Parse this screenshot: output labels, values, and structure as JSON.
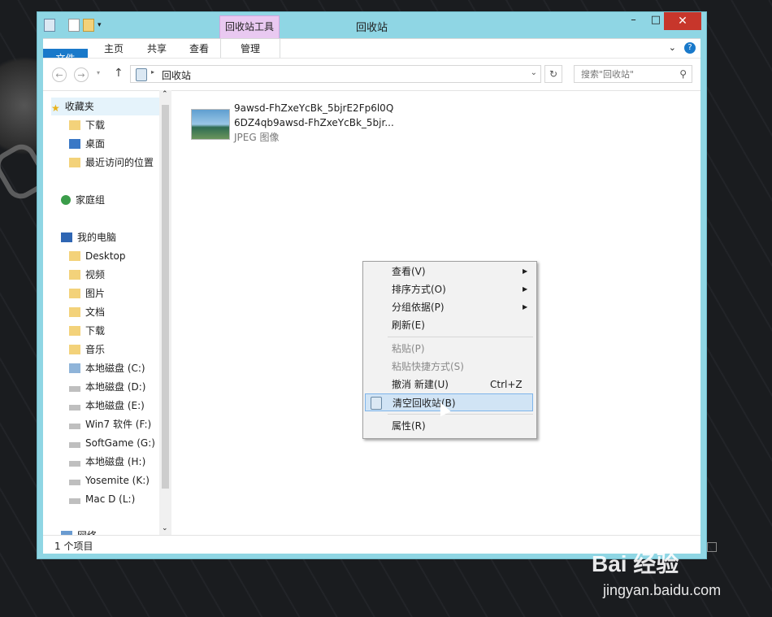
{
  "window": {
    "title": "回收站",
    "context_tab": "回收站工具",
    "close": "✕",
    "minimize": "–",
    "maximize": "□"
  },
  "ribbon": {
    "tabs": [
      "文件",
      "主页",
      "共享",
      "查看",
      "管理"
    ]
  },
  "address": {
    "path": "回收站",
    "search_placeholder": "搜索\"回收站\""
  },
  "sidebar": {
    "items": [
      {
        "label": "收藏夹"
      },
      {
        "label": "下载"
      },
      {
        "label": "桌面"
      },
      {
        "label": "最近访问的位置"
      },
      {
        "label": "家庭组"
      },
      {
        "label": "我的电脑"
      },
      {
        "label": "Desktop"
      },
      {
        "label": "视频"
      },
      {
        "label": "图片"
      },
      {
        "label": "文档"
      },
      {
        "label": "下载"
      },
      {
        "label": "音乐"
      },
      {
        "label": "本地磁盘 (C:)"
      },
      {
        "label": "本地磁盘 (D:)"
      },
      {
        "label": "本地磁盘 (E:)"
      },
      {
        "label": "Win7 软件 (F:)"
      },
      {
        "label": "SoftGame (G:)"
      },
      {
        "label": "本地磁盘 (H:)"
      },
      {
        "label": "Yosemite (K:)"
      },
      {
        "label": "Mac D (L:)"
      },
      {
        "label": "网络"
      }
    ]
  },
  "file": {
    "name_line1": "9awsd-FhZxeYcBk_5bjrE2Fp6l0Q",
    "name_line2": "6DZ4qb9awsd-FhZxeYcBk_5bjr...",
    "type": "JPEG 图像"
  },
  "status": {
    "count": "1 个项目"
  },
  "context_menu": {
    "items": [
      {
        "label": "查看(V)"
      },
      {
        "label": "排序方式(O)"
      },
      {
        "label": "分组依据(P)"
      },
      {
        "label": "刷新(E)"
      },
      {
        "label": "粘贴(P)"
      },
      {
        "label": "粘贴快捷方式(S)"
      },
      {
        "label": "撤消 新建(U)",
        "shortcut": "Ctrl+Z"
      },
      {
        "label": "清空回收站(B)"
      },
      {
        "label": "属性(R)"
      }
    ]
  },
  "watermark": {
    "brand": "Bai 经验",
    "url": "jingyan.baidu.com"
  },
  "colors": {
    "accent": "#1979ca",
    "frame": "#8fd6e4",
    "close": "#c7362b",
    "context_tab": "#e9c9f1",
    "highlight": "#d1e4f5"
  }
}
